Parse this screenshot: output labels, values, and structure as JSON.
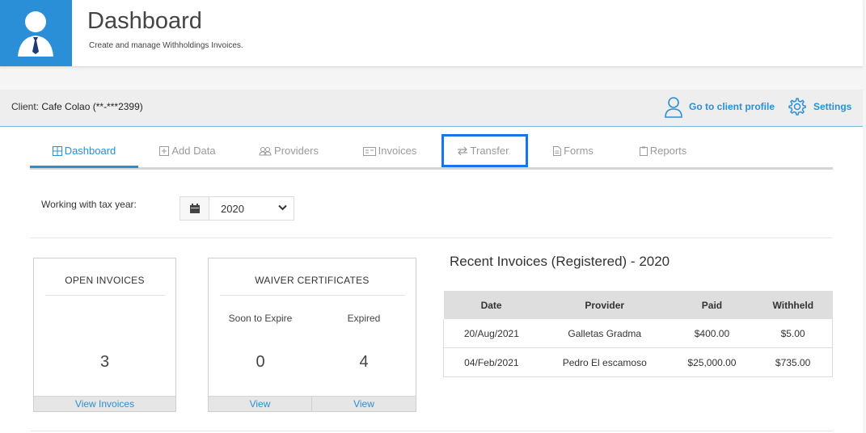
{
  "header": {
    "title": "Dashboard",
    "subtitle": "Create and manage Withholdings Invoices.",
    "avatar_icon": "user-avatar-icon",
    "accent": "#2a8fd6"
  },
  "client_bar": {
    "client_prefix": "Client:",
    "client_name": "Cafe Colao (**-***2399)",
    "profile_link": "Go to client profile",
    "settings_link": "Settings"
  },
  "tabs": [
    {
      "label": "Dashboard",
      "icon": "grid-icon",
      "active": true
    },
    {
      "label": "Add Data",
      "icon": "plus-square-icon"
    },
    {
      "label": "Providers",
      "icon": "users-icon"
    },
    {
      "label": "Invoices",
      "icon": "invoice-icon"
    },
    {
      "label": "Transfer",
      "icon": "transfer-icon",
      "highlighted": true
    },
    {
      "label": "Forms",
      "icon": "file-icon"
    },
    {
      "label": "Reports",
      "icon": "clipboard-icon"
    }
  ],
  "tax_year": {
    "label": "Working with tax year:",
    "value": "2020"
  },
  "open_invoices": {
    "title": "OPEN INVOICES",
    "count": "3",
    "link": "View Invoices"
  },
  "waiver": {
    "title": "WAIVER CERTIFICATES",
    "soon_label": "Soon to Expire",
    "expired_label": "Expired",
    "soon_count": "0",
    "expired_count": "4",
    "soon_link": "View",
    "expired_link": "View"
  },
  "recent": {
    "title": "Recent Invoices (Registered) - 2020",
    "columns": [
      "Date",
      "Provider",
      "Paid",
      "Withheld"
    ],
    "rows": [
      [
        "20/Aug/2021",
        "Galletas Gradma",
        "$400.00",
        "$5.00"
      ],
      [
        "04/Feb/2021",
        "Pedro El escamoso",
        "$25,000.00",
        "$735.00"
      ]
    ]
  }
}
